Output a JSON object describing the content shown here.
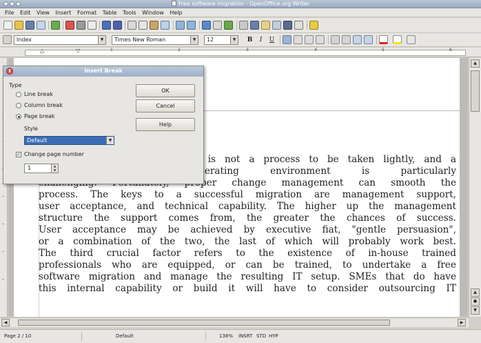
{
  "window": {
    "title": "Free software migration - OpenOffice.org Writer"
  },
  "menu": [
    "File",
    "Edit",
    "View",
    "Insert",
    "Format",
    "Table",
    "Tools",
    "Window",
    "Help"
  ],
  "formatting": {
    "style": "Index",
    "font": "Times New Roman",
    "size": "12",
    "bold": "B",
    "italic": "I",
    "underline": "U"
  },
  "ruler": {
    "numbers": [
      "1",
      "2",
      "3",
      "4",
      "5",
      "6"
    ]
  },
  "document": {
    "lines": [
      "n is not a process to be taken lightly, and a",
      "operating environment is particularly",
      "challenging. Fortunately, proper change management can smooth the",
      "process. The keys to a successful migration are management support,",
      "user acceptance, and technical capability. The higher up the management",
      "structure the support comes from, the greater the chances of success.",
      "User acceptance may be achieved by executive fiat, \"gentle persuasion\",",
      "or a combination of the two, the last of which will probably work best.",
      "The third crucial factor refers to the existence of in-house trained",
      "professionals who are equipped, or can be trained, to undertake a free",
      "software migration and manage the resulting IT setup. SMEs that do have",
      "this internal capability or build it will have to consider outsourcing IT"
    ]
  },
  "dialog": {
    "title": "Insert Break",
    "type_label": "Type",
    "options": [
      "Line break",
      "Column break",
      "Page break"
    ],
    "selected_option": "Page break",
    "style_label": "Style",
    "style_value": "Default",
    "change_page_number_label": "Change page number",
    "change_page_number_checked": true,
    "page_number_value": "1",
    "ok_label": "OK",
    "cancel_label": "Cancel",
    "help_label": "Help"
  },
  "status": {
    "page": "Page 2 / 10",
    "style": "Default",
    "zoom": "138%",
    "insert_mode": "INSRT",
    "selection_mode": "STD",
    "hyperlink_mode": "HYP"
  }
}
